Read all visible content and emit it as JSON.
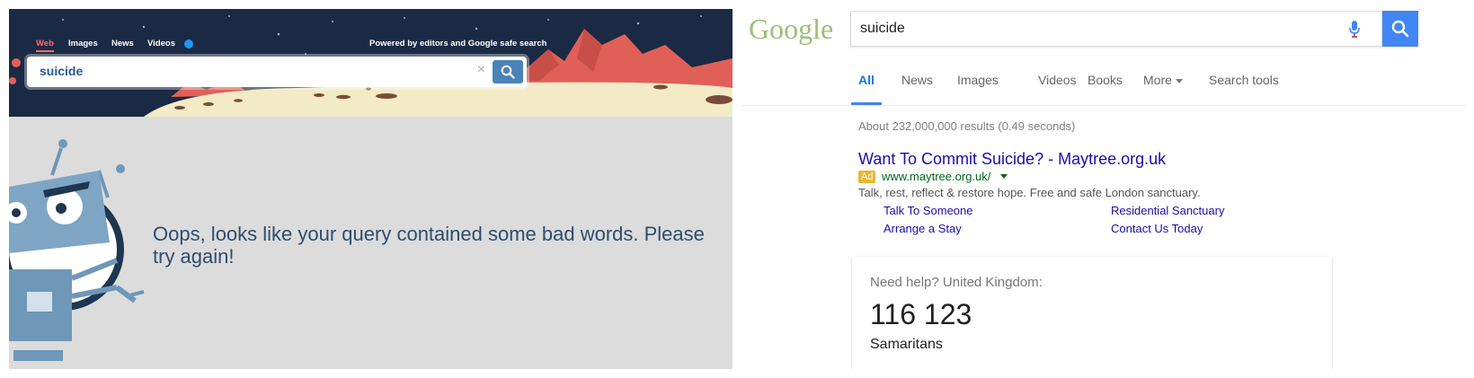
{
  "left_panel": {
    "tabs": [
      {
        "label": "Web",
        "active": true
      },
      {
        "label": "Images"
      },
      {
        "label": "News"
      },
      {
        "label": "Videos"
      }
    ],
    "powered_by": "Powered by editors and Google safe search",
    "search": {
      "value": "suicide",
      "clear_glyph": "×"
    },
    "error_message": "Oops, looks like your query contained some bad words. Please try again!",
    "colors": {
      "header_bg": "#1b2a44",
      "panel_bg": "#dcdcdc",
      "active_tab": "#ff6b6b",
      "search_button": "#4a83b8",
      "error_text": "#2e4d6e"
    },
    "icons": {
      "search_button": "search-icon",
      "robot": "robot-illustration"
    }
  },
  "right_panel": {
    "logo": "Google",
    "search": {
      "value": "suicide"
    },
    "tabs": [
      {
        "label": "All",
        "active": true
      },
      {
        "label": "News"
      },
      {
        "label": "Images"
      },
      {
        "label": "Videos"
      },
      {
        "label": "Books"
      },
      {
        "label": "More"
      },
      {
        "label": "Search tools"
      }
    ],
    "result_stats": "About 232,000,000 results (0.49 seconds)",
    "ad": {
      "title": "Want To Commit Suicide? - Maytree.org.uk",
      "badge": "Ad",
      "url": "www.maytree.org.uk/",
      "description": "Talk, rest, reflect & restore hope. Free and safe London sanctuary.",
      "sitelinks": [
        "Talk To Someone",
        "Residential Sanctuary",
        "Arrange a Stay",
        "Contact Us Today"
      ]
    },
    "help_card": {
      "title": "Need help? United Kingdom:",
      "number": "116 123",
      "organization": "Samaritans"
    },
    "colors": {
      "link": "#1a0dab",
      "url": "#006621",
      "accent": "#4285f4",
      "ad_badge": "#e9b734",
      "logo": "#9bbf78"
    },
    "icons": {
      "mic": "microphone-icon",
      "search_button": "search-icon",
      "more_dropdown": "caret-down-icon"
    }
  }
}
